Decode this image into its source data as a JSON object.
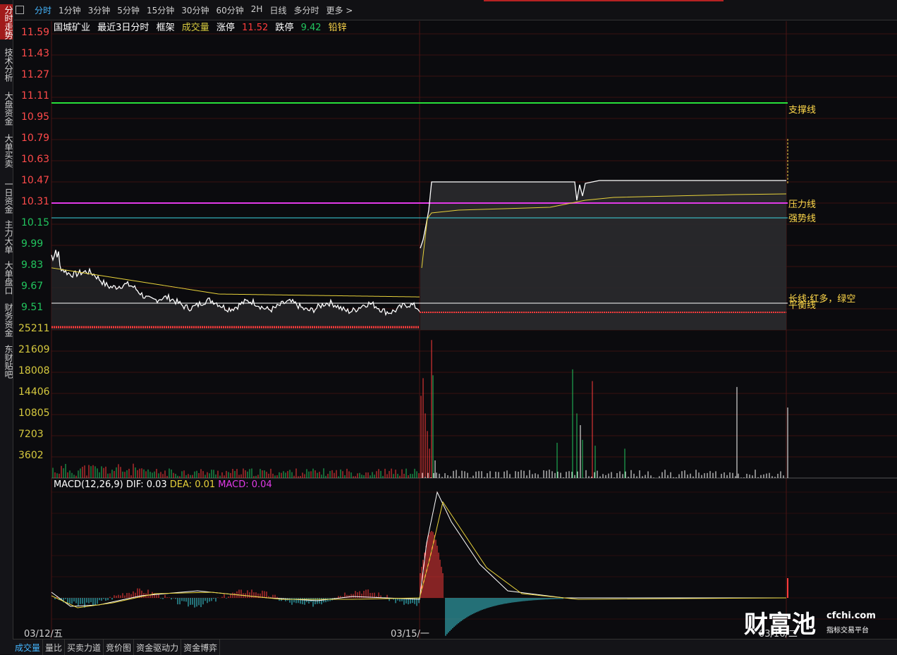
{
  "periods": [
    "分时",
    "1分钟",
    "3分钟",
    "5分钟",
    "15分钟",
    "30分钟",
    "60分钟",
    "2H",
    "日线",
    "多分时",
    "更多 >"
  ],
  "left_tabs": [
    "分时走势",
    "技术分析",
    "大盘资金",
    "大单买卖",
    "一日资金",
    "主力大单",
    "大单盘口",
    "财务资金",
    "东财贴吧"
  ],
  "info": {
    "name": "国城矿业",
    "range": "最近3日分时",
    "frame": "框架",
    "volume_label": "成交量",
    "limit_up_label": "涨停",
    "limit_up": "11.52",
    "limit_down_label": "跌停",
    "limit_down": "9.42",
    "sector": "铅锌"
  },
  "price_axis": [
    "11.59",
    "11.43",
    "11.27",
    "11.11",
    "10.95",
    "10.79",
    "10.63",
    "10.47",
    "10.31",
    "10.15",
    "9.99",
    "9.83",
    "9.67",
    "9.51"
  ],
  "volume_axis": [
    "25211",
    "21609",
    "18008",
    "14406",
    "10805",
    "7203",
    "3602"
  ],
  "right_labels": {
    "support": "支撑线",
    "pressure": "压力线",
    "strong": "强势线",
    "long": "长线:红多，绿空",
    "balance": "平衡线"
  },
  "macd": {
    "title": "MACD(12,26,9)",
    "dif_label": "DIF: 0.03",
    "dea_label": "DEA: 0.01",
    "macd_label": "MACD: 0.04"
  },
  "dates": [
    "03/12/五",
    "03/15/一",
    "03/16/二"
  ],
  "bottom_tabs": [
    "成交量",
    "量比",
    "买卖力道",
    "竞价图",
    "资金驱动力",
    "资金博弈"
  ],
  "watermark": {
    "brand": "财富池",
    "site": "cfchi.com",
    "slogan": "指标交易平台"
  },
  "colors": {
    "up": "#ff3b3b",
    "down": "#22c55e",
    "support": "#27e03a",
    "pressure": "#e23ae8",
    "strong": "#3dd6e0",
    "avg": "#e8d23a",
    "price": "#ffffff",
    "accent": "#45b6ff"
  }
}
